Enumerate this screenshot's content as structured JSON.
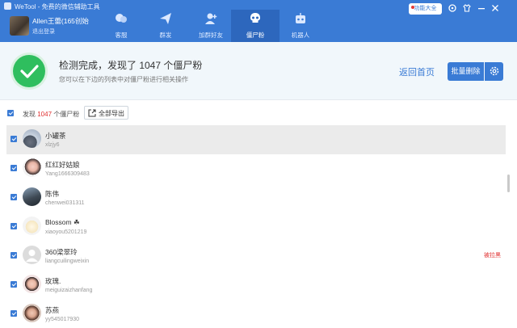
{
  "window": {
    "title": "WeTool - 免费的微信辅助工具"
  },
  "user": {
    "name": "Allen王蕾(165创始",
    "logout": "退出登录"
  },
  "nav": [
    {
      "label": "客服",
      "icon": "chat-icon"
    },
    {
      "label": "群发",
      "icon": "send-icon"
    },
    {
      "label": "加群好友",
      "icon": "add-user-icon"
    },
    {
      "label": "僵尸粉",
      "icon": "skull-icon",
      "active": true
    },
    {
      "label": "机器人",
      "icon": "robot-icon"
    }
  ],
  "toolbar": {
    "feature_label": "功能大全"
  },
  "result": {
    "title": "检测完成，发现了 1047 个僵尸粉",
    "subtitle": "您可以在下边的列表中对僵尸粉进行相关操作",
    "back_home": "返回首页",
    "batch_delete": "批量删除"
  },
  "filter": {
    "found_prefix": "发现",
    "found_count": "1047",
    "found_suffix": "个僵尸粉",
    "export_label": "全部导出"
  },
  "contacts": [
    {
      "name": "小罐茶",
      "id": "xlzjy6",
      "selected": true,
      "tag": ""
    },
    {
      "name": "红红好姑娘",
      "id": "Yang1666309483",
      "selected": false,
      "tag": ""
    },
    {
      "name": "陈伟",
      "id": "chenwei031311",
      "selected": false,
      "tag": ""
    },
    {
      "name": "Blossom ☘",
      "id": "xiaoyou5201219",
      "selected": false,
      "tag": ""
    },
    {
      "name": "360梁翠玲",
      "id": "liangcuilingweixin",
      "selected": false,
      "tag": "被拉黑"
    },
    {
      "name": "玫瑰.",
      "id": "meiguizaizhanfang",
      "selected": false,
      "tag": ""
    },
    {
      "name": "苏燕",
      "id": "yy545017930",
      "selected": false,
      "tag": ""
    }
  ],
  "colors": {
    "accent": "#3a7bd5",
    "success": "#2fbe5e",
    "danger": "#e03131"
  }
}
